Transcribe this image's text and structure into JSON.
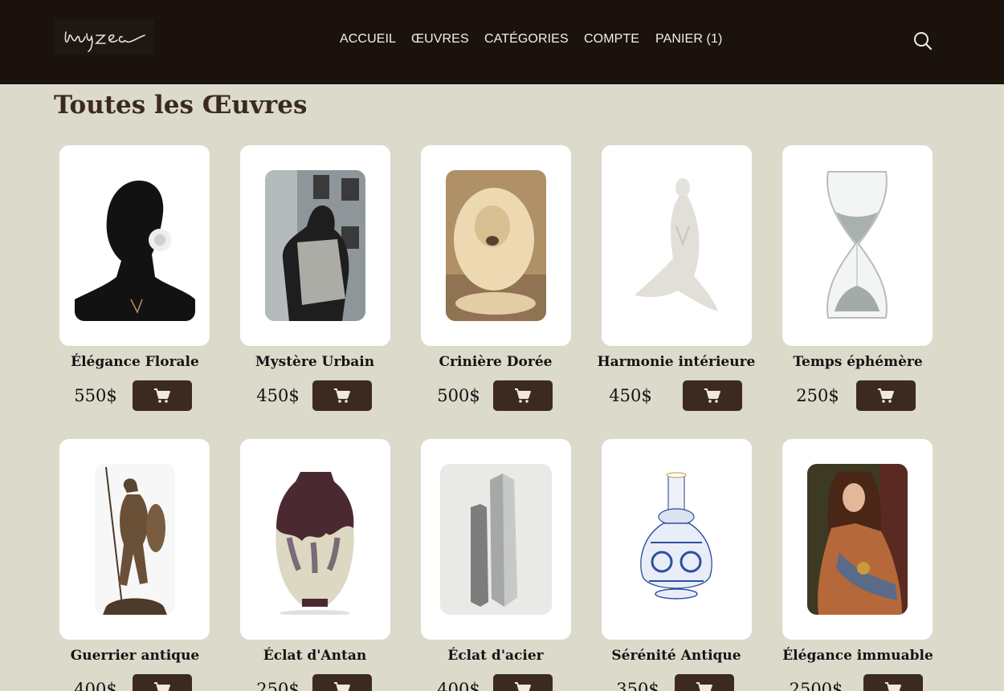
{
  "header": {
    "logo_text": "myzea",
    "nav": [
      "ACCUEIL",
      "ŒUVRES",
      "CATÉGORIES",
      "COMPTE",
      "PANIER (1)"
    ]
  },
  "page": {
    "title": "Toutes les Œuvres"
  },
  "products": [
    {
      "name": "Élégance Florale",
      "price": "550$"
    },
    {
      "name": "Mystère Urbain",
      "price": "450$"
    },
    {
      "name": "Crinière Dorée",
      "price": "500$"
    },
    {
      "name": "Harmonie intérieure",
      "price": "450$"
    },
    {
      "name": "Temps éphémère",
      "price": "250$"
    },
    {
      "name": "Guerrier antique",
      "price": "400$"
    },
    {
      "name": "Éclat d'Antan",
      "price": "250$"
    },
    {
      "name": "Éclat d'acier",
      "price": "400$"
    },
    {
      "name": "Sérénité Antique",
      "price": "350$"
    },
    {
      "name": "Élégance immuable",
      "price": "2500$"
    }
  ],
  "icons": {
    "search": "search-icon",
    "cart": "cart-icon"
  },
  "colors": {
    "header_bg": "#1c120d",
    "page_bg": "#dbdacb",
    "button_bg": "#3c2a21",
    "title": "#3b2921"
  }
}
